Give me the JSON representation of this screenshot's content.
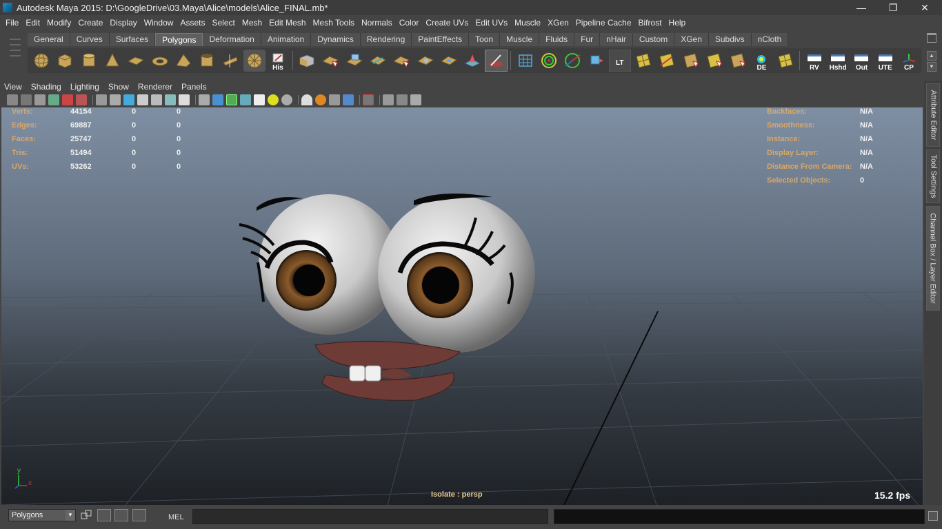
{
  "window": {
    "title": "Autodesk Maya 2015: D:\\GoogleDrive\\03.Maya\\Alice\\models\\Alice_FINAL.mb*",
    "minimize": "—",
    "restore": "❐",
    "close": "✕"
  },
  "main_menu": [
    "File",
    "Edit",
    "Modify",
    "Create",
    "Display",
    "Window",
    "Assets",
    "Select",
    "Mesh",
    "Edit Mesh",
    "Mesh Tools",
    "Normals",
    "Color",
    "Create UVs",
    "Edit UVs",
    "Muscle",
    "XGen",
    "Pipeline Cache",
    "Bifrost",
    "Help"
  ],
  "shelf": {
    "tabs": [
      "General",
      "Curves",
      "Surfaces",
      "Polygons",
      "Deformation",
      "Animation",
      "Dynamics",
      "Rendering",
      "PaintEffects",
      "Toon",
      "Muscle",
      "Fluids",
      "Fur",
      "nHair",
      "Custom",
      "XGen",
      "Subdivs",
      "nCloth"
    ],
    "active_tab": "Polygons",
    "icon_labels": {
      "his": "His",
      "lt": "LT",
      "de": "DE",
      "rv": "RV",
      "hshd": "Hshd",
      "out": "Out",
      "ute": "UTE",
      "cp": "CP"
    }
  },
  "panel_menu": [
    "View",
    "Shading",
    "Lighting",
    "Show",
    "Renderer",
    "Panels"
  ],
  "hud": {
    "left": [
      {
        "label": "Verts:",
        "v1": "44154",
        "v2": "0",
        "v3": "0"
      },
      {
        "label": "Edges:",
        "v1": "69887",
        "v2": "0",
        "v3": "0"
      },
      {
        "label": "Faces:",
        "v1": "25747",
        "v2": "0",
        "v3": "0"
      },
      {
        "label": "Tris:",
        "v1": "51494",
        "v2": "0",
        "v3": "0"
      },
      {
        "label": "UVs:",
        "v1": "53262",
        "v2": "0",
        "v3": "0"
      }
    ],
    "right": [
      {
        "label": "Backfaces:",
        "value": "N/A"
      },
      {
        "label": "Smoothness:",
        "value": "N/A"
      },
      {
        "label": "Instance:",
        "value": "N/A"
      },
      {
        "label": "Display Layer:",
        "value": "N/A"
      },
      {
        "label": "Distance From Camera:",
        "value": "N/A"
      },
      {
        "label": "Selected Objects:",
        "value": "0"
      }
    ],
    "isolate": "Isolate : persp",
    "fps": "15.2 fps",
    "axis_y": "y",
    "axis_x": "x"
  },
  "side_tabs": [
    "Attribute Editor",
    "Tool Settings",
    "Channel Box / Layer Editor"
  ],
  "bottom": {
    "mode": "Polygons",
    "mel_label": "MEL",
    "mel_value": ""
  },
  "colors": {
    "hud_label": "#d8a86c",
    "hud_value": "#f0f0f0",
    "iris": "#8a5a2b",
    "lips": "#6e3b36"
  }
}
